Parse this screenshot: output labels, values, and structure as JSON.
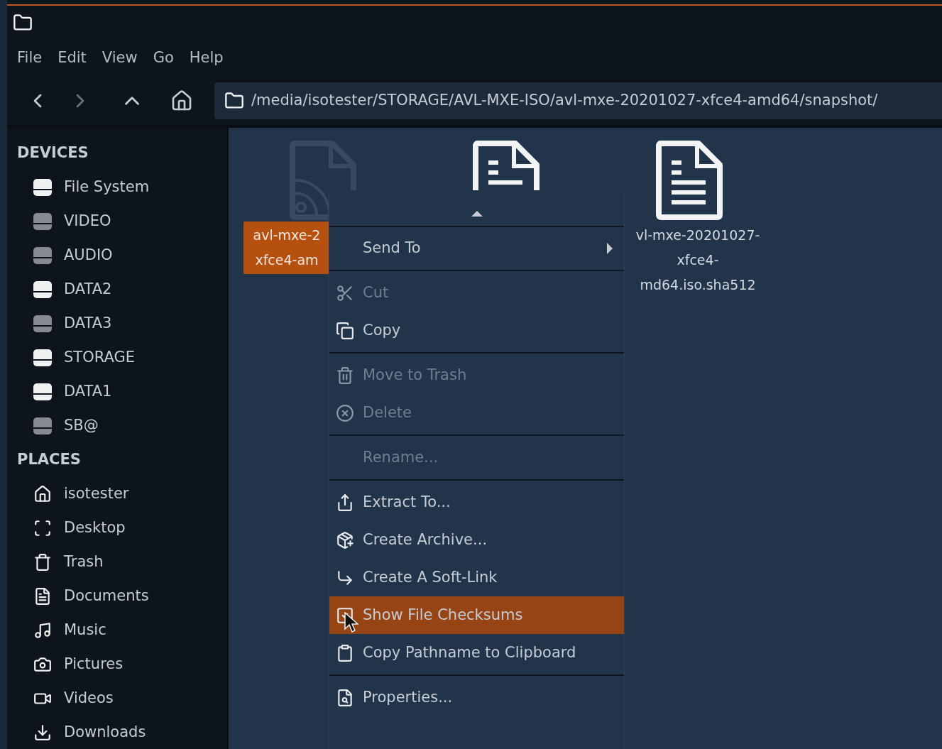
{
  "menubar": [
    "File",
    "Edit",
    "View",
    "Go",
    "Help"
  ],
  "location": {
    "path": "/media/isotester/STORAGE/AVL-MXE-ISO/avl-mxe-20201027-xfce4-amd64/snapshot/"
  },
  "sidebar": [
    {
      "title": "DEVICES",
      "items": [
        {
          "label": "File System",
          "mounted": true
        },
        {
          "label": "VIDEO",
          "mounted": false
        },
        {
          "label": "AUDIO",
          "mounted": false
        },
        {
          "label": "DATA2",
          "mounted": true
        },
        {
          "label": "DATA3",
          "mounted": false
        },
        {
          "label": "STORAGE",
          "mounted": true
        },
        {
          "label": "DATA1",
          "mounted": true
        },
        {
          "label": "SB@",
          "mounted": false
        }
      ]
    },
    {
      "title": "PLACES",
      "items": [
        {
          "label": "isotester"
        },
        {
          "label": "Desktop"
        },
        {
          "label": "Trash"
        },
        {
          "label": "Documents"
        },
        {
          "label": "Music"
        },
        {
          "label": "Pictures"
        },
        {
          "label": "Videos"
        },
        {
          "label": "Downloads"
        }
      ]
    }
  ],
  "files": [
    {
      "kind": "disc",
      "selected": true,
      "name_lines": [
        "avl-mxe-2",
        "xfce4-am"
      ]
    },
    {
      "kind": "document",
      "selected": false
    },
    {
      "kind": "document",
      "selected": false,
      "name_lines": [
        "vl-mxe-20201027-",
        "xfce4-",
        "md64.iso.sha512"
      ]
    }
  ],
  "context_menu": {
    "sections": [
      [
        {
          "label": "Send To",
          "submenu": true,
          "disabled": false,
          "selected": false
        }
      ],
      [
        {
          "label": "Cut",
          "submenu": false,
          "disabled": true,
          "selected": false
        },
        {
          "label": "Copy",
          "submenu": false,
          "disabled": false,
          "selected": false
        }
      ],
      [
        {
          "label": "Move to Trash",
          "submenu": false,
          "disabled": true,
          "selected": false
        },
        {
          "label": "Delete",
          "submenu": false,
          "disabled": true,
          "selected": false
        }
      ],
      [
        {
          "label": "Rename...",
          "submenu": false,
          "disabled": true,
          "selected": false
        }
      ],
      [
        {
          "label": "Extract To...",
          "submenu": false,
          "disabled": false,
          "selected": false
        },
        {
          "label": "Create Archive...",
          "submenu": false,
          "disabled": false,
          "selected": false
        },
        {
          "label": "Create A Soft-Link",
          "submenu": false,
          "disabled": false,
          "selected": false
        },
        {
          "label": "Show File Checksums",
          "submenu": false,
          "disabled": false,
          "selected": true
        },
        {
          "label": "Copy Pathname to Clipboard",
          "submenu": false,
          "disabled": false,
          "selected": false
        }
      ],
      [
        {
          "label": "Properties...",
          "submenu": false,
          "disabled": false,
          "selected": false
        }
      ]
    ]
  }
}
